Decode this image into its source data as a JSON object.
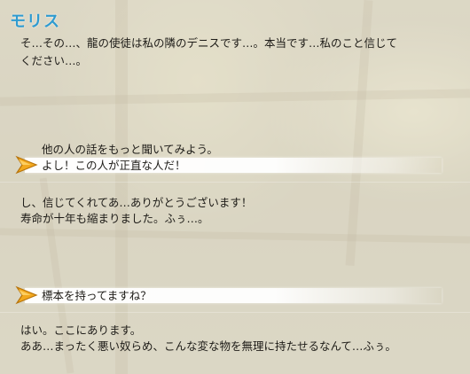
{
  "speaker": "モリス",
  "dialogue_1": [
    "そ…その…、龍の使徒は私の隣のデニスです…。本当です…私のこと信じて",
    "ください…。"
  ],
  "choices_1": {
    "option_plain": "他の人の話をもっと聞いてみよう。",
    "option_selected": "よし！この人が正直な人だ！"
  },
  "dialogue_2": [
    "し、信じてくれてあ…ありがとうございます！",
    "寿命が十年も縮まりました。ふぅ…。"
  ],
  "choices_2": {
    "option_selected": "標本を持ってますね？"
  },
  "dialogue_3": [
    "はい。ここにあります。",
    "ああ…まったく悪い奴らめ、こんな変な物を無理に持たせるなんて…ふぅ。"
  ],
  "colors": {
    "speaker": "#2f9bd0",
    "cursor": "#f2a81e"
  },
  "icons": {
    "cursor": "arrow-cursor-icon"
  }
}
